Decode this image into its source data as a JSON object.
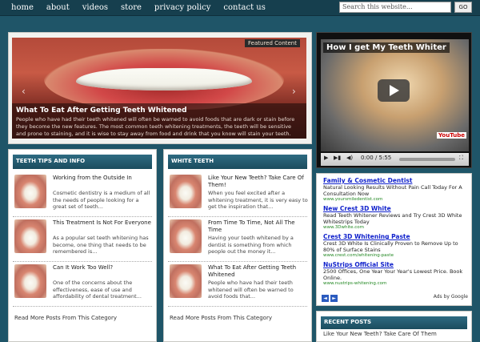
{
  "nav": {
    "items": [
      "home",
      "about",
      "videos",
      "store",
      "privacy policy",
      "contact us"
    ],
    "search_placeholder": "Search this website...",
    "go_label": "GO"
  },
  "feature": {
    "label": "Featured Content",
    "title": "What To Eat After Getting Teeth Whitened",
    "excerpt": "People who have had their teeth whitened will often be warned to avoid foods that are dark or stain before they become the new features. The most common teeth whitening treatments, the teeth will be sensitive and prone to staining, and it is wise to stay away from food and drink that you know will stain your teeth. Foods that don't stain include..."
  },
  "video": {
    "title": "How I get My Teeth Whiter",
    "time": "0:00 / 5:55",
    "brand": "YouTube"
  },
  "categories": [
    {
      "heading": "Teeth Tips and Info",
      "posts": [
        {
          "title": "Working from the Outside In",
          "excerpt": "Cosmetic dentistry is a medium of all the needs of people looking for a great set of teeth..."
        },
        {
          "title": "This Treatment Is Not For Everyone",
          "excerpt": "As a popular set teeth whitening has become, one thing that needs to be remembered is..."
        },
        {
          "title": "Can It Work Too Well?",
          "excerpt": "One of the concerns about the effectiveness, ease of use and affordability of dental treatment..."
        }
      ],
      "read_more": "Read More Posts From This Category"
    },
    {
      "heading": "White Teeth",
      "posts": [
        {
          "title": "Like Your New Teeth? Take Care Of Them!",
          "excerpt": "When you feel excited after a whitening treatment, it is very easy to get the inspiration that..."
        },
        {
          "title": "From Time To Time, Not All The Time",
          "excerpt": "Having your teeth whitened by a dentist is something from which people out the money it..."
        },
        {
          "title": "What To Eat After Getting Teeth Whitened",
          "excerpt": "People who have had their teeth whitened will often be warned to avoid foods that..."
        }
      ],
      "read_more": "Read More Posts From This Category"
    }
  ],
  "ads": {
    "items": [
      {
        "title": "Family & Cosmetic Dentist",
        "desc": "Natural Looking Results Without Pain Call Today For A Consultation Now",
        "url": "www.yoursmiledentist.com"
      },
      {
        "title": "New Crest 3D White",
        "desc": "Read Teeth Whitener Reviews and Try Crest 3D White Whitestrips Today",
        "url": "www.3Dwhite.com"
      },
      {
        "title": "Crest 3D Whitening Paste",
        "desc": "Crest 3D White Is Clinically Proven to Remove Up to 80% of Surface Stains",
        "url": "www.crest.com/whitening-paste"
      },
      {
        "title": "NuStrips Official Site",
        "desc": "2500 Offices, One Year Your Year's Lowest Price. Book Online.",
        "url": "www.nustrips-whitening.com"
      }
    ],
    "by_label": "Ads by Google",
    "prev": "◄",
    "next": "►"
  },
  "recent": {
    "heading": "Recent Posts",
    "items": [
      "Like Your New Teeth? Take Care Of Them"
    ]
  },
  "colors": {
    "background": "#1f5568",
    "nav_bg": "#163f4e",
    "header_bar": "#1b4c5e",
    "ad_link": "#1122cc"
  }
}
